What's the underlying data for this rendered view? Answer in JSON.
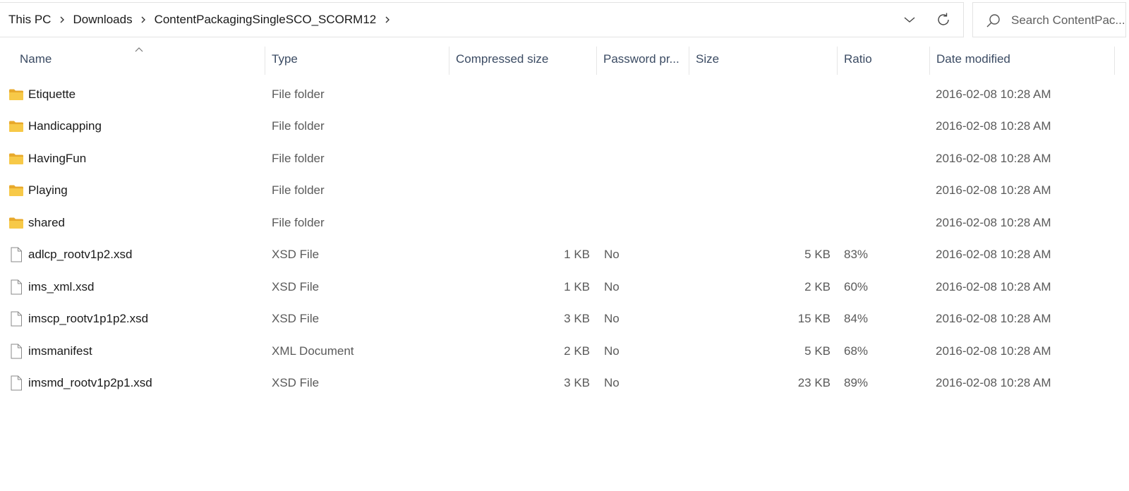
{
  "breadcrumb": {
    "items": [
      "This PC",
      "Downloads",
      "ContentPackagingSingleSCO_SCORM12"
    ]
  },
  "search": {
    "placeholder": "Search ContentPac..."
  },
  "columns": {
    "name": "Name",
    "type": "Type",
    "compressed_size": "Compressed size",
    "password": "Password pr...",
    "size": "Size",
    "ratio": "Ratio",
    "date_modified": "Date modified"
  },
  "sort": {
    "column": "name",
    "direction": "ascending"
  },
  "colors": {
    "folder": "#f5c544",
    "folder_dark": "#e8a92b",
    "header_text": "#3b4b63"
  },
  "files": [
    {
      "name": "Etiquette",
      "icon": "folder-icon",
      "type": "File folder",
      "compressed_size": "",
      "password": "",
      "size": "",
      "ratio": "",
      "date": "2016-02-08 10:28 AM"
    },
    {
      "name": "Handicapping",
      "icon": "folder-icon",
      "type": "File folder",
      "compressed_size": "",
      "password": "",
      "size": "",
      "ratio": "",
      "date": "2016-02-08 10:28 AM"
    },
    {
      "name": "HavingFun",
      "icon": "folder-icon",
      "type": "File folder",
      "compressed_size": "",
      "password": "",
      "size": "",
      "ratio": "",
      "date": "2016-02-08 10:28 AM"
    },
    {
      "name": "Playing",
      "icon": "folder-icon",
      "type": "File folder",
      "compressed_size": "",
      "password": "",
      "size": "",
      "ratio": "",
      "date": "2016-02-08 10:28 AM"
    },
    {
      "name": "shared",
      "icon": "folder-icon",
      "type": "File folder",
      "compressed_size": "",
      "password": "",
      "size": "",
      "ratio": "",
      "date": "2016-02-08 10:28 AM"
    },
    {
      "name": "adlcp_rootv1p2.xsd",
      "icon": "file-icon",
      "type": "XSD File",
      "compressed_size": "1 KB",
      "password": "No",
      "size": "5 KB",
      "ratio": "83%",
      "date": "2016-02-08 10:28 AM"
    },
    {
      "name": "ims_xml.xsd",
      "icon": "file-icon",
      "type": "XSD File",
      "compressed_size": "1 KB",
      "password": "No",
      "size": "2 KB",
      "ratio": "60%",
      "date": "2016-02-08 10:28 AM"
    },
    {
      "name": "imscp_rootv1p1p2.xsd",
      "icon": "file-icon",
      "type": "XSD File",
      "compressed_size": "3 KB",
      "password": "No",
      "size": "15 KB",
      "ratio": "84%",
      "date": "2016-02-08 10:28 AM"
    },
    {
      "name": "imsmanifest",
      "icon": "file-icon",
      "type": "XML Document",
      "compressed_size": "2 KB",
      "password": "No",
      "size": "5 KB",
      "ratio": "68%",
      "date": "2016-02-08 10:28 AM"
    },
    {
      "name": "imsmd_rootv1p2p1.xsd",
      "icon": "file-icon",
      "type": "XSD File",
      "compressed_size": "3 KB",
      "password": "No",
      "size": "23 KB",
      "ratio": "89%",
      "date": "2016-02-08 10:28 AM"
    }
  ]
}
